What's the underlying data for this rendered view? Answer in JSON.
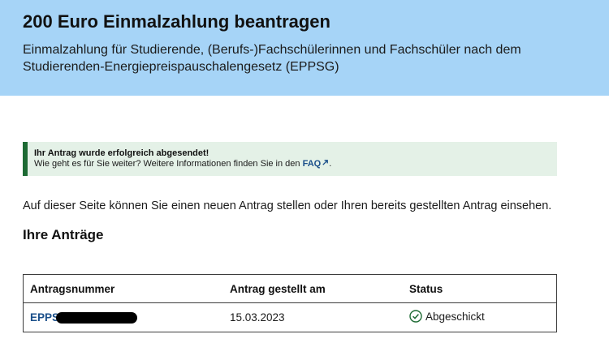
{
  "header": {
    "title": "200 Euro Einmalzahlung beantragen",
    "subtitle": "Einmalzahlung für Studierende, (Berufs-)Fachschülerinnen und Fachschüler nach dem Studierenden-Energiepreispauschalengesetz (EPPSG)"
  },
  "alert": {
    "title": "Ihr Antrag wurde erfolgreich abgesendet!",
    "body_prefix": "Wie geht es für Sie weiter? Weitere Informationen finden Sie in den ",
    "faq_link": "FAQ",
    "body_suffix": ".",
    "color": "#1e6b34"
  },
  "intro": "Auf dieser Seite können Sie einen neuen Antrag stellen oder Ihren bereits gestellten Antrag einsehen.",
  "applications": {
    "title": "Ihre Anträge",
    "columns": [
      "Antragsnummer",
      "Antrag gestellt am",
      "Status"
    ],
    "rows": [
      {
        "number": "EPPS",
        "date": "15.03.2023",
        "status": "Abgeschickt",
        "status_icon": "check-circle-icon"
      }
    ]
  }
}
